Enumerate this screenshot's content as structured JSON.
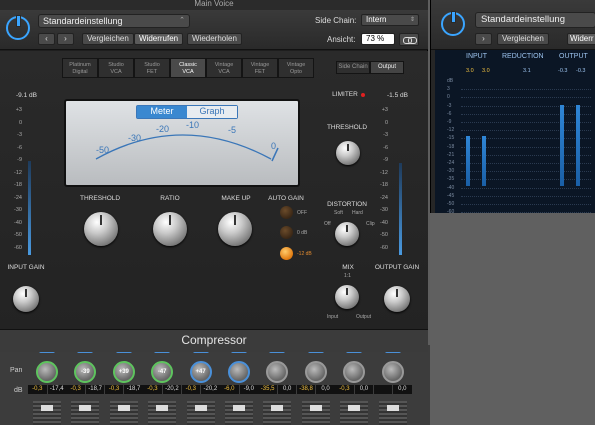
{
  "title": "Main Voice",
  "header": {
    "preset": "Standardeinstellung",
    "compare": "Vergleichen",
    "undo": "Widerrufen",
    "redo": "Wiederholen",
    "sidechain_label": "Side Chain:",
    "sidechain_value": "Intern",
    "view_label": "Ansicht:",
    "view_value": "73 %"
  },
  "models": [
    {
      "line1": "Platinum",
      "line2": "Digital"
    },
    {
      "line1": "Studio",
      "line2": "VCA"
    },
    {
      "line1": "Studio",
      "line2": "FET"
    },
    {
      "line1": "Classic",
      "line2": "VCA"
    },
    {
      "line1": "Vintage",
      "line2": "VCA"
    },
    {
      "line1": "Vintage",
      "line2": "FET"
    },
    {
      "line1": "Vintage",
      "line2": "Opto"
    }
  ],
  "tabs": {
    "sidechain": "Side Chain",
    "output": "Output"
  },
  "meter": {
    "tab_meter": "Meter",
    "tab_graph": "Graph",
    "scale": [
      "-50",
      "-30",
      "-20",
      "-10",
      "-5",
      "0"
    ]
  },
  "levels": {
    "input": "-9.1 dB",
    "output": "-1.5 dB"
  },
  "left_scale": [
    "+3",
    "0",
    "-3",
    "-6",
    "-9",
    "-12",
    "-18",
    "-24",
    "-30",
    "-40",
    "-50",
    "-60"
  ],
  "right_scale": [
    "+3",
    "0",
    "-3",
    "-6",
    "-9",
    "-12",
    "-18",
    "-24",
    "-30",
    "-40",
    "-50",
    "-60"
  ],
  "controls": {
    "threshold": "THRESHOLD",
    "ratio": "RATIO",
    "makeup": "MAKE UP",
    "auto_gain": "AUTO GAIN",
    "auto_off": "OFF",
    "auto_0": "0 dB",
    "auto_12": "-12 dB",
    "limiter": "LIMITER",
    "threshold_r": "THRESHOLD",
    "distortion": "DISTORTION",
    "dist_off": "Off",
    "dist_soft": "Soft",
    "dist_hard": "Hard",
    "dist_clip": "Clip",
    "mix": "MIX",
    "mix_ratio": "1:1",
    "mix_input": "Input",
    "mix_output": "Output",
    "input_gain": "INPUT GAIN",
    "output_gain": "OUTPUT GAIN",
    "db": "dB"
  },
  "footer": {
    "name": "Compressor"
  },
  "mixer": {
    "pan": "Pan",
    "db": "dB",
    "strips": [
      {
        "knob": "",
        "v1": "-0,3",
        "v2": "-17,4",
        "color": "green"
      },
      {
        "knob": "-39",
        "v1": "-0,3",
        "v2": "-18,7",
        "color": "green"
      },
      {
        "knob": "+39",
        "v1": "-0,3",
        "v2": "-18,7",
        "color": "green"
      },
      {
        "knob": "-47",
        "v1": "-0,3",
        "v2": "-20,2",
        "color": "green"
      },
      {
        "knob": "+47",
        "v1": "-0,3",
        "v2": "-20,2",
        "color": "blue"
      },
      {
        "knob": "",
        "v1": "-6,0",
        "v2": "-9,0",
        "color": "blue"
      },
      {
        "knob": "",
        "v1": "-35,5",
        "v2": "0,0",
        "color": "grey"
      },
      {
        "knob": "",
        "v1": "-38,8",
        "v2": "0,0",
        "color": "grey"
      },
      {
        "knob": "",
        "v1": "-0,3",
        "v2": "0,0",
        "color": "grey"
      },
      {
        "knob": "",
        "v1": "",
        "v2": "0,0",
        "color": "grey"
      }
    ]
  },
  "right_window": {
    "preset": "Standardeinstellung",
    "compare": "Vergleichen",
    "undo": "Widerr",
    "col_input": "INPUT",
    "col_reduction": "REDUCTION",
    "col_output": "OUTPUT",
    "in_vals": [
      "3.0",
      "3.0"
    ],
    "red_val": "3.1",
    "out_vals": [
      "-0.3",
      "-0.3"
    ],
    "scale": [
      "dB",
      "3",
      "0",
      "-3",
      "-6",
      "-9",
      "-12",
      "-15",
      "-18",
      "-21",
      "-24",
      "-30",
      "-35",
      "-40",
      "-45",
      "-50",
      "-60"
    ]
  }
}
